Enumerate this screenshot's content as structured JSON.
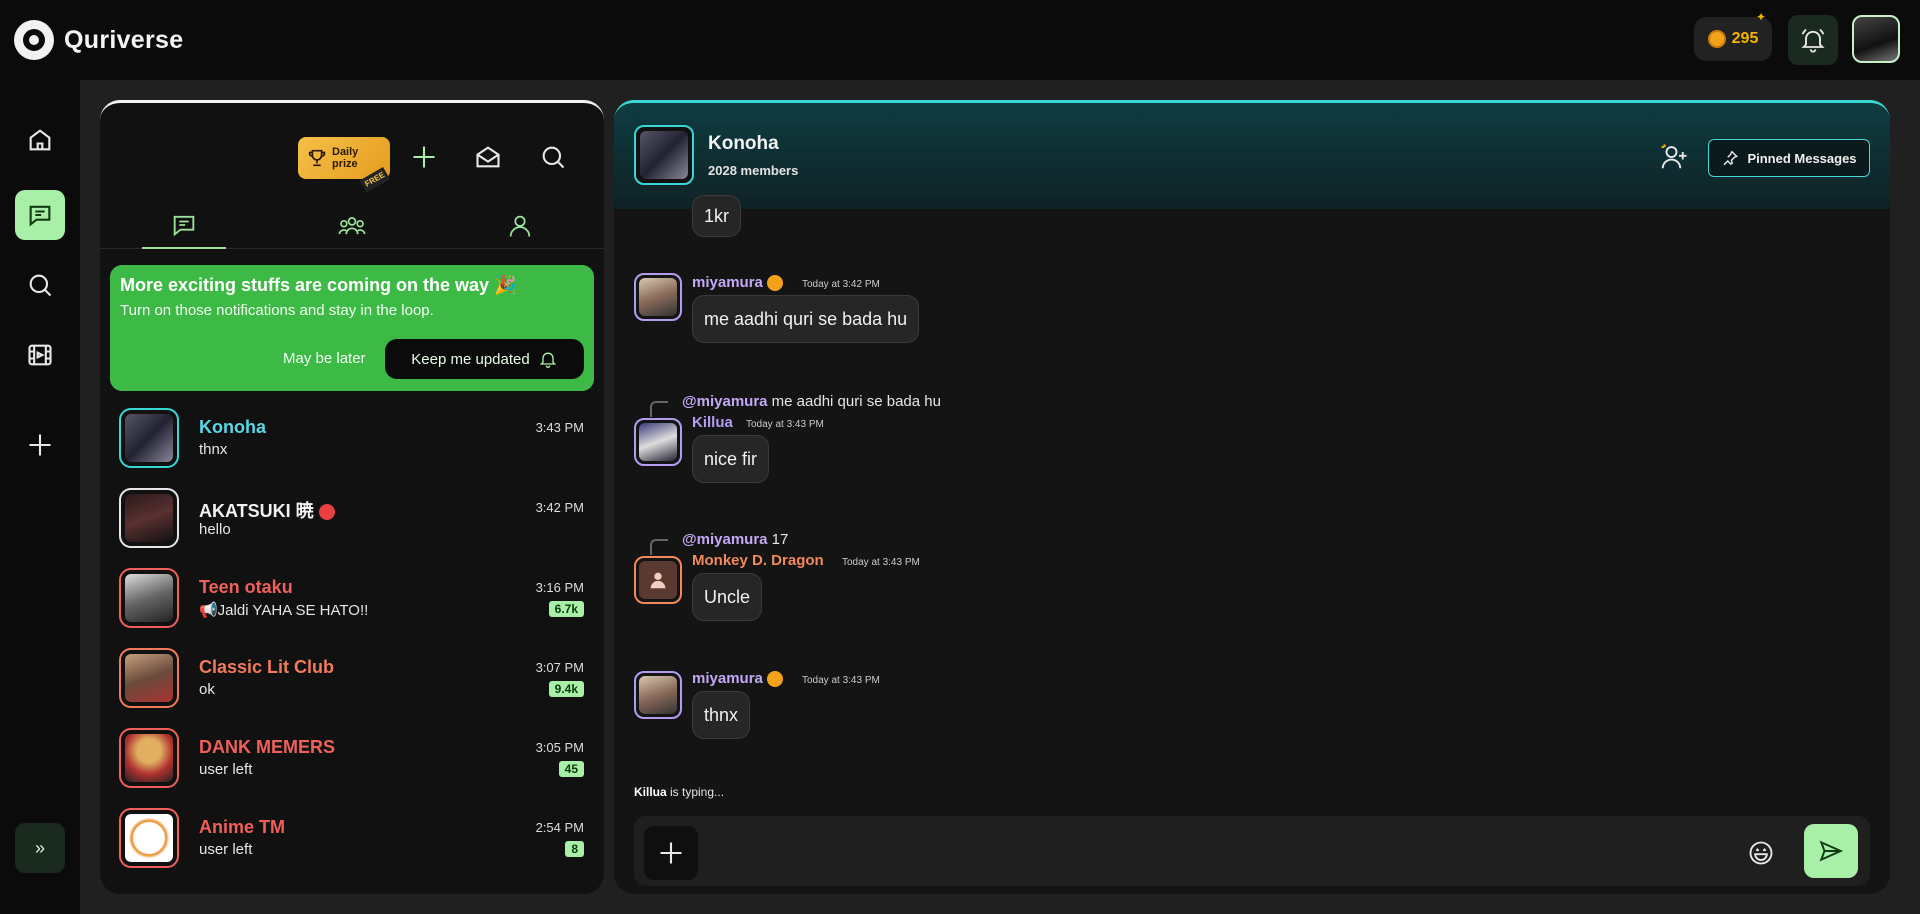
{
  "app": {
    "name": "Quriverse"
  },
  "topbar": {
    "coins": "295"
  },
  "list": {
    "daily_prize": {
      "line1": "Daily",
      "line2": "prize",
      "tag": "FREE"
    },
    "banner": {
      "title": "More exciting stuffs are coming on the way 🎉",
      "subtitle": "Turn on those notifications and stay in the loop.",
      "later": "May be later",
      "keep": "Keep me updated"
    },
    "chats": [
      {
        "name": "Konoha",
        "last": "thnx",
        "time": "3:43 PM",
        "count": "",
        "name_color": "#5ad7e6",
        "border": "#39d6d6"
      },
      {
        "name": "AKATSUKI 暁",
        "last": "hello",
        "time": "3:42 PM",
        "count": "",
        "name_color": "#f2f2f2",
        "border": "#e6e6e6"
      },
      {
        "name": "Teen otaku",
        "last": "📢Jaldi YAHA SE HATO!!",
        "time": "3:16 PM",
        "count": "6.7k",
        "name_color": "#f0605a",
        "border": "#f0605a"
      },
      {
        "name": "Classic Lit Club",
        "last": "ok",
        "time": "3:07 PM",
        "count": "9.4k",
        "name_color": "#f07a5a",
        "border": "#f07a5a"
      },
      {
        "name": "DANK MEMERS",
        "last": "user left",
        "time": "3:05 PM",
        "count": "45",
        "name_color": "#f0605a",
        "border": "#f0605a"
      },
      {
        "name": "Anime TM",
        "last": "user left",
        "time": "2:54 PM",
        "count": "8",
        "name_color": "#f0605a",
        "border": "#f0605a"
      }
    ]
  },
  "conversation": {
    "title": "Konoha",
    "members": "2028 members",
    "pinned_label": "Pinned Messages",
    "partial_bubble": "1kr",
    "messages": [
      {
        "user": "miyamura",
        "time": "Today at 3:42 PM",
        "text": "me aadhi quri se bada hu",
        "user_color": "#c3a8f5"
      },
      {
        "reply_to": "@miyamura",
        "reply_text": "me aadhi quri se bada hu",
        "user": "Killua",
        "time": "Today at 3:43 PM",
        "text": "nice fir",
        "user_color": "#b49cf0"
      },
      {
        "reply_to": "@miyamura",
        "reply_text": "17",
        "user": "Monkey D. Dragon",
        "time": "Today at 3:43 PM",
        "text": "Uncle",
        "user_color": "#f08a5a"
      },
      {
        "user": "miyamura",
        "time": "Today at 3:43 PM",
        "text": "thnx",
        "user_color": "#c3a8f5"
      }
    ],
    "typing_user": "Killua",
    "typing_suffix": " is typing..."
  }
}
